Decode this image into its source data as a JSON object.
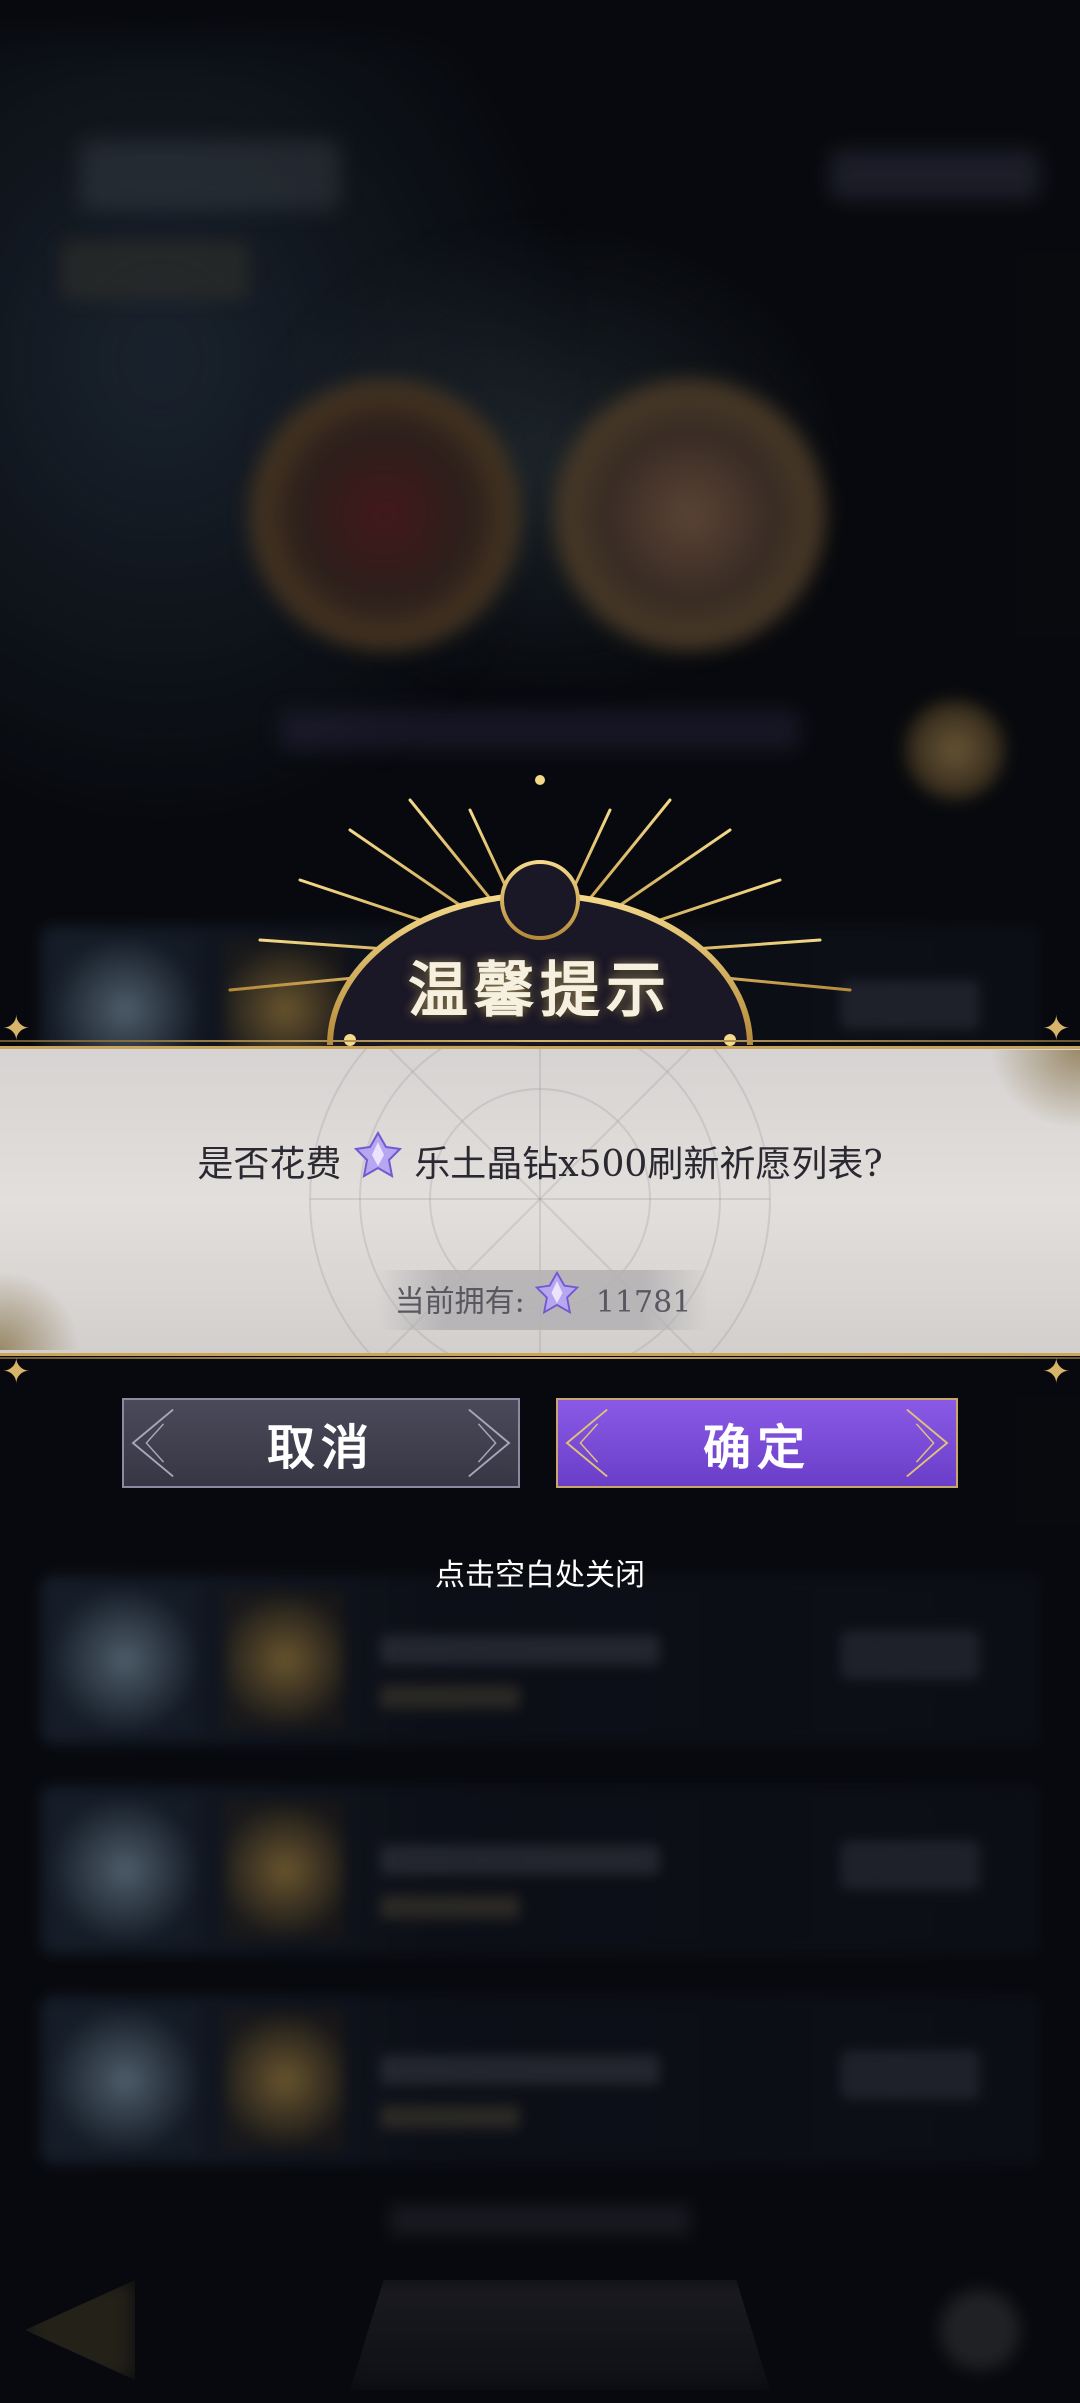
{
  "dialog": {
    "title": "温馨提示",
    "question_prefix": "是否花费",
    "question_suffix": "乐土晶钻x500刷新祈愿列表?",
    "owned_label": "当前拥有:",
    "owned_count": "11781",
    "cancel_label": "取消",
    "confirm_label": "确定",
    "close_hint": "点击空白处关闭"
  },
  "icons": {
    "gem": "crystal-diamond-icon"
  },
  "colors": {
    "accent_gold": "#d8b46a",
    "confirm_purple": "#7a4ad8",
    "cancel_gray": "#3e3e4c",
    "panel": "#dcd9d7"
  }
}
